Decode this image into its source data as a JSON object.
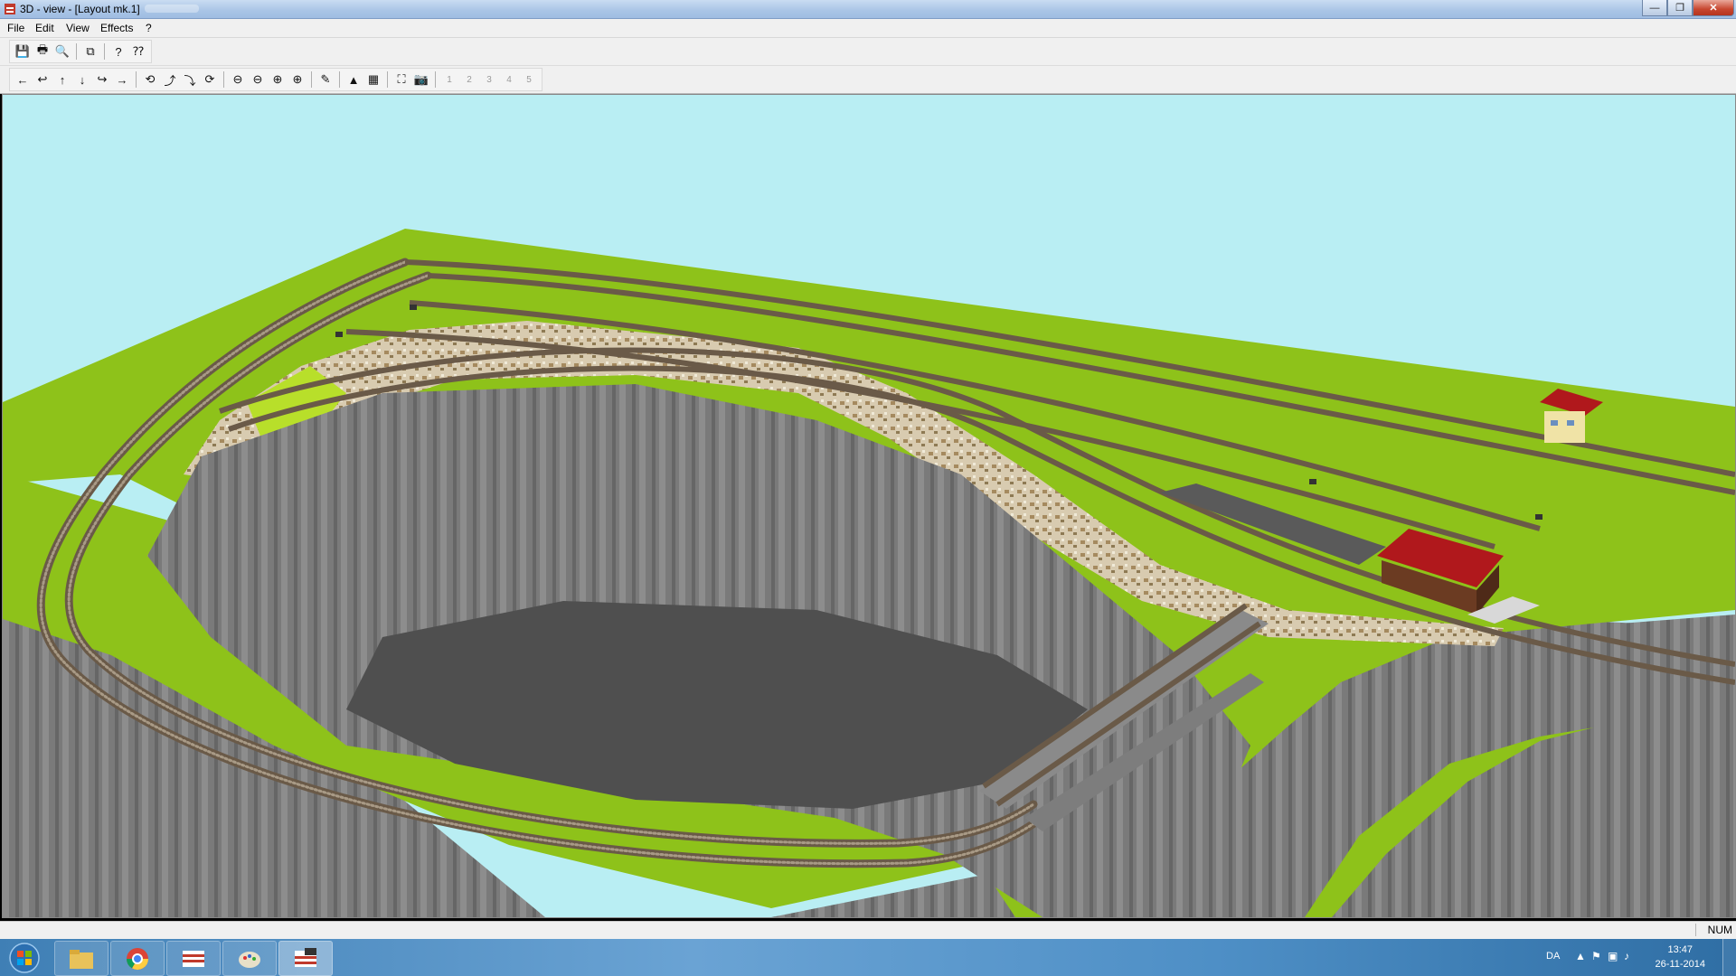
{
  "window": {
    "title": "3D - view - [Layout mk.1]",
    "buttons": {
      "minimize": "—",
      "maximize": "❐",
      "close": "✕"
    }
  },
  "menu": [
    {
      "label": "File"
    },
    {
      "label": "Edit"
    },
    {
      "label": "View"
    },
    {
      "label": "Effects"
    },
    {
      "label": "?"
    }
  ],
  "toolbar_main": [
    {
      "icon": "save-icon",
      "glyph": "💾"
    },
    {
      "icon": "print-icon",
      "glyph": "🖶"
    },
    {
      "icon": "print-preview-icon",
      "glyph": "🔍"
    },
    {
      "icon": "copy-icon",
      "glyph": "⧉"
    },
    {
      "icon": "help-icon",
      "glyph": "?"
    },
    {
      "icon": "context-help-icon",
      "glyph": "⁇"
    }
  ],
  "toolbar_view": {
    "navigation": [
      "←",
      "↩",
      "↑",
      "↓",
      "↪",
      "→"
    ],
    "camera": [
      "⟲",
      "⤴",
      "⤵",
      "⟳"
    ],
    "zoom": [
      "⊖",
      "⊖",
      "⊕",
      "⊕"
    ],
    "tools": [
      "✎"
    ],
    "terrain": [
      "▲",
      "▦"
    ],
    "capture": [
      "⛶",
      "📷"
    ],
    "presets": [
      "1",
      "2",
      "3",
      "4",
      "5"
    ]
  },
  "status": {
    "num": "NUM"
  },
  "taskbar": {
    "language": "DA",
    "time": "13:47",
    "date": "26-11-2014"
  },
  "colors": {
    "sky": "#b9eef3",
    "grass": "#8ec21a",
    "cliff": "#7c7c7c",
    "pit_floor": "#4f4f4f",
    "roof": "#b0181c",
    "titlebar": "#a9c4e6"
  }
}
